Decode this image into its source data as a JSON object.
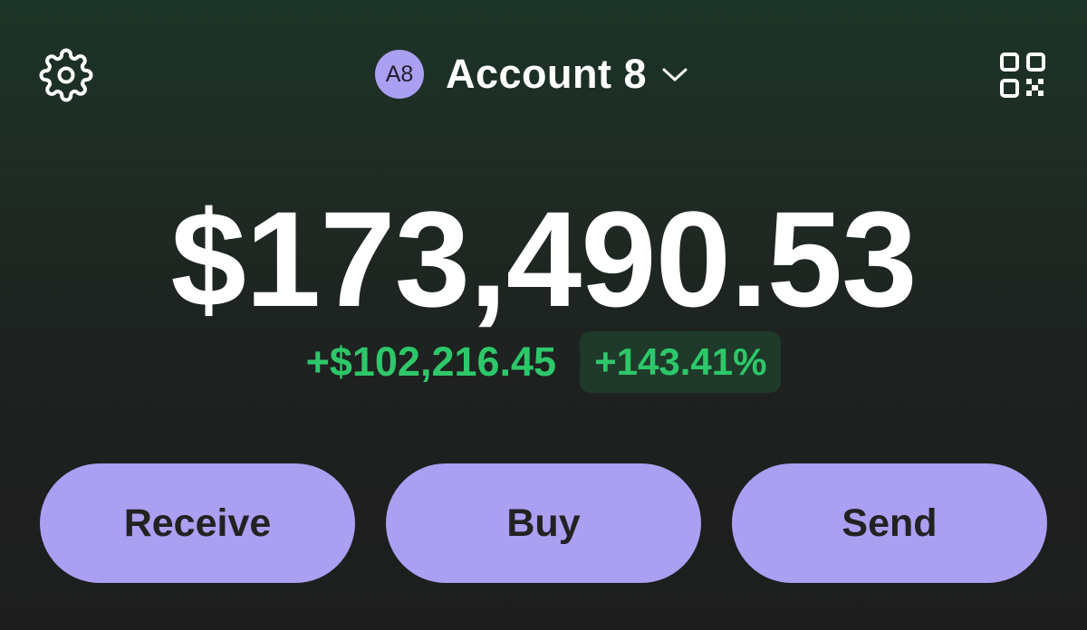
{
  "header": {
    "settings_icon": "gear-icon",
    "qr_icon": "qr-code-icon",
    "account": {
      "avatar_initials": "A8",
      "name": "Account 8",
      "dropdown_icon": "chevron-down-icon"
    }
  },
  "portfolio": {
    "balance": "$173,490.53",
    "change_amount": "+$102,216.45",
    "change_percent": "+143.41%"
  },
  "actions": {
    "receive_label": "Receive",
    "buy_label": "Buy",
    "send_label": "Send"
  },
  "colors": {
    "accent": "#ab9ff2",
    "positive": "#2ec76a",
    "positive_badge_bg": "#1f3a2a"
  }
}
